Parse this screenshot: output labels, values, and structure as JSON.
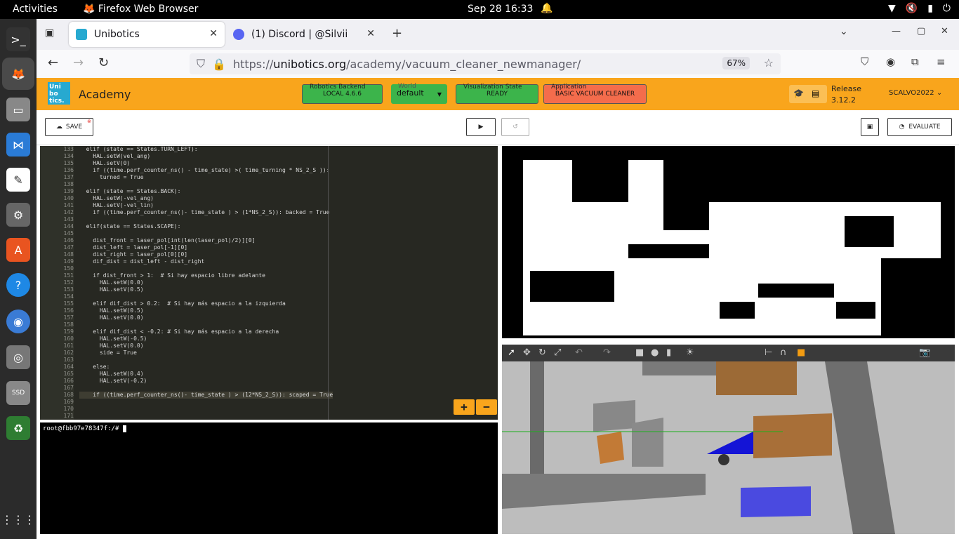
{
  "os": {
    "activities": "Activities",
    "app": "Firefox Web Browser",
    "clock": "Sep 28  16:33"
  },
  "tabs": [
    {
      "label": "Unibotics"
    },
    {
      "label": "(1) Discord | @Silvii"
    }
  ],
  "url": {
    "prefix": "https://",
    "host": "unibotics.org",
    "path": "/academy/vacuum_cleaner_newmanager/",
    "zoom": "67%"
  },
  "header": {
    "brand": "Academy",
    "logo_text": "Uni bo tics.",
    "backend_cap": "Robotics Backend",
    "backend_val": "LOCAL 4.6.6",
    "world_cap": "World",
    "world_val": "default",
    "vis_cap": "Visualization State",
    "vis_val": "READY",
    "app_cap": "Application",
    "app_val": "BASIC VACUUM CLEANER",
    "release_cap": "Release",
    "release_val": "3.12.2",
    "user": "SCALVO2022"
  },
  "toolbar": {
    "save": "SAVE",
    "evaluate": "EVALUATE"
  },
  "code": {
    "start": 133,
    "highlight": 168,
    "lines": [
      "  elif (state == States.TURN_LEFT):",
      "    HAL.setW(vel_ang)",
      "    HAL.setV(0)",
      "    if ((time.perf_counter_ns() - time_state) >( time_turning * NS_2_S )):",
      "      turned = True",
      "",
      "  elif (state == States.BACK):",
      "    HAL.setW(-vel_ang)",
      "    HAL.setV(-vel_lin)",
      "    if ((time.perf_counter_ns()- time_state ) > (1*NS_2_S)): backed = True",
      "",
      "  elif(state == States.SCAPE):",
      "",
      "    dist_front = laser_pol[int(len(laser_pol)/2)][0]",
      "    dist_left = laser_pol[-1][0]",
      "    dist_right = laser_pol[0][0]",
      "    dif_dist = dist_left - dist_right",
      "",
      "    if dist_front > 1:  # Si hay espacio libre adelante",
      "      HAL.setW(0.0)",
      "      HAL.setV(0.5)",
      "",
      "    elif dif_dist > 0.2:  # Si hay más espacio a la izquierda",
      "      HAL.setW(0.5)",
      "      HAL.setV(0.0)",
      "",
      "    elif dif_dist < -0.2: # Si hay más espacio a la derecha",
      "      HAL.setW(-0.5)",
      "      HAL.setV(0.0)",
      "      side = True",
      "",
      "    else:",
      "      HAL.setW(0.4)",
      "      HAL.setV(-0.2)",
      "",
      "    if ((time.perf_counter_ns()- time_state ) > (12*NS_2_S)): scaped = True",
      "",
      "",
      ""
    ]
  },
  "terminal": {
    "prompt": "root@fbb97e78347f:/# "
  }
}
